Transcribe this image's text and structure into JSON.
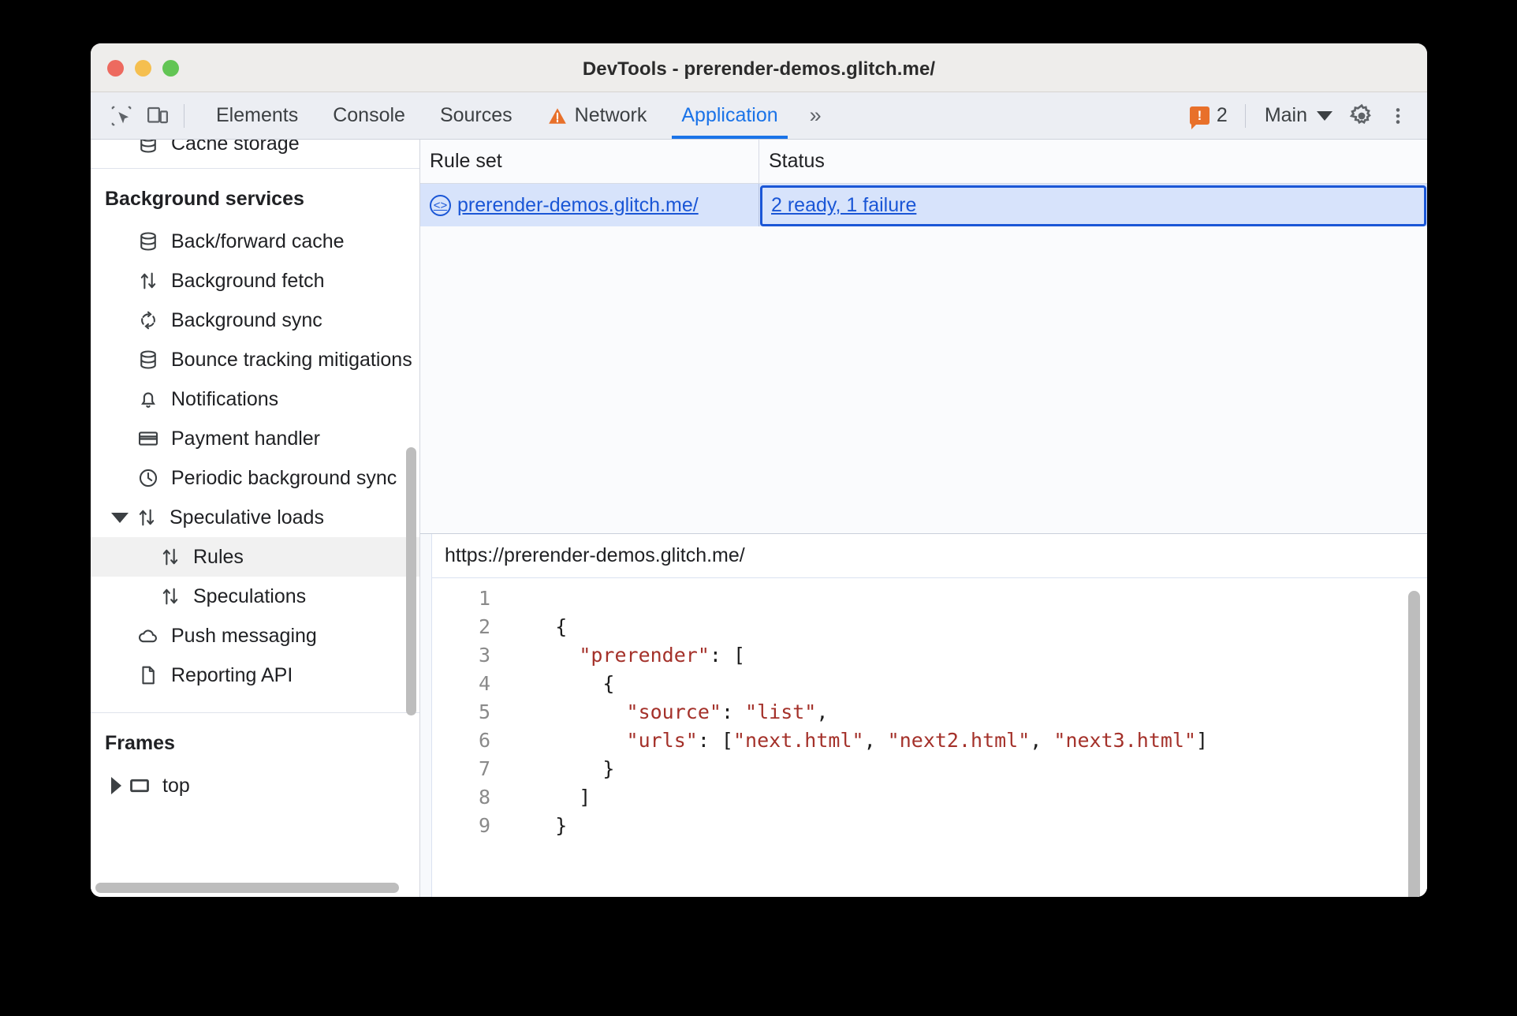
{
  "window": {
    "title": "DevTools - prerender-demos.glitch.me/",
    "traffic_lights": [
      "close",
      "minimize",
      "zoom"
    ]
  },
  "toolbar": {
    "inspect_icon": "inspect-element-icon",
    "device_icon": "device-toolbar-icon",
    "tabs": [
      {
        "label": "Elements",
        "active": false,
        "warning": false
      },
      {
        "label": "Console",
        "active": false,
        "warning": false
      },
      {
        "label": "Sources",
        "active": false,
        "warning": false
      },
      {
        "label": "Network",
        "active": false,
        "warning": true
      },
      {
        "label": "Application",
        "active": true,
        "warning": false
      }
    ],
    "more_tabs_label": "»",
    "error_badge": {
      "icon": "!",
      "count": "2"
    },
    "context_selector": "Main",
    "settings_icon": "gear-icon",
    "more_options_icon": "kebab-menu-icon",
    "accent_color": "#1a73e8",
    "warning_color": "#e8702a"
  },
  "sidebar": {
    "clipped_top_item": "Cache storage",
    "sections": [
      {
        "title": "Background services",
        "items": [
          {
            "label": "Back/forward cache",
            "icon": "database-icon",
            "indent": 1,
            "selected": false
          },
          {
            "label": "Background fetch",
            "icon": "updown-arrows-icon",
            "indent": 1,
            "selected": false
          },
          {
            "label": "Background sync",
            "icon": "sync-icon",
            "indent": 1,
            "selected": false
          },
          {
            "label": "Bounce tracking mitigations",
            "icon": "database-icon",
            "indent": 1,
            "selected": false
          },
          {
            "label": "Notifications",
            "icon": "bell-icon",
            "indent": 1,
            "selected": false
          },
          {
            "label": "Payment handler",
            "icon": "credit-card-icon",
            "indent": 1,
            "selected": false
          },
          {
            "label": "Periodic background sync",
            "icon": "clock-icon",
            "indent": 1,
            "selected": false
          },
          {
            "label": "Speculative loads",
            "icon": "updown-arrows-icon",
            "indent": 1,
            "selected": false,
            "expanded": true
          },
          {
            "label": "Rules",
            "icon": "updown-arrows-icon",
            "indent": 2,
            "selected": true
          },
          {
            "label": "Speculations",
            "icon": "updown-arrows-icon",
            "indent": 2,
            "selected": false
          },
          {
            "label": "Push messaging",
            "icon": "cloud-icon",
            "indent": 1,
            "selected": false
          },
          {
            "label": "Reporting API",
            "icon": "document-icon",
            "indent": 1,
            "selected": false
          }
        ]
      },
      {
        "title": "Frames",
        "items": [
          {
            "label": "top",
            "icon": "frame-icon",
            "indent": 1,
            "selected": false,
            "collapsed": true
          }
        ]
      }
    ]
  },
  "rule_set_grid": {
    "columns": [
      "Rule set",
      "Status"
    ],
    "rows": [
      {
        "rule_set": "prerender-demos.glitch.me/",
        "rule_set_icon": "code-source-icon",
        "status": "2 ready, 1 failure",
        "selected": true,
        "status_focused": true
      }
    ]
  },
  "source_viewer": {
    "header": "https://prerender-demos.glitch.me/",
    "lines": [
      {
        "num": "1",
        "segments": []
      },
      {
        "num": "2",
        "segments": [
          {
            "t": "    {",
            "c": "ct"
          }
        ]
      },
      {
        "num": "3",
        "segments": [
          {
            "t": "      ",
            "c": "ct"
          },
          {
            "t": "\"prerender\"",
            "c": "str"
          },
          {
            "t": ": [",
            "c": "ct"
          }
        ]
      },
      {
        "num": "4",
        "segments": [
          {
            "t": "        {",
            "c": "ct"
          }
        ]
      },
      {
        "num": "5",
        "segments": [
          {
            "t": "          ",
            "c": "ct"
          },
          {
            "t": "\"source\"",
            "c": "str"
          },
          {
            "t": ": ",
            "c": "ct"
          },
          {
            "t": "\"list\"",
            "c": "str"
          },
          {
            "t": ",",
            "c": "ct"
          }
        ]
      },
      {
        "num": "6",
        "segments": [
          {
            "t": "          ",
            "c": "ct"
          },
          {
            "t": "\"urls\"",
            "c": "str"
          },
          {
            "t": ": [",
            "c": "ct"
          },
          {
            "t": "\"next.html\"",
            "c": "str"
          },
          {
            "t": ", ",
            "c": "ct"
          },
          {
            "t": "\"next2.html\"",
            "c": "str"
          },
          {
            "t": ", ",
            "c": "ct"
          },
          {
            "t": "\"next3.html\"",
            "c": "str"
          },
          {
            "t": "]",
            "c": "ct"
          }
        ]
      },
      {
        "num": "7",
        "segments": [
          {
            "t": "        }",
            "c": "ct"
          }
        ]
      },
      {
        "num": "8",
        "segments": [
          {
            "t": "      ]",
            "c": "ct"
          }
        ]
      },
      {
        "num": "9",
        "segments": [
          {
            "t": "    }",
            "c": "ct"
          }
        ]
      }
    ],
    "string_color": "#a4312a",
    "text_color": "#1c1c1c"
  }
}
